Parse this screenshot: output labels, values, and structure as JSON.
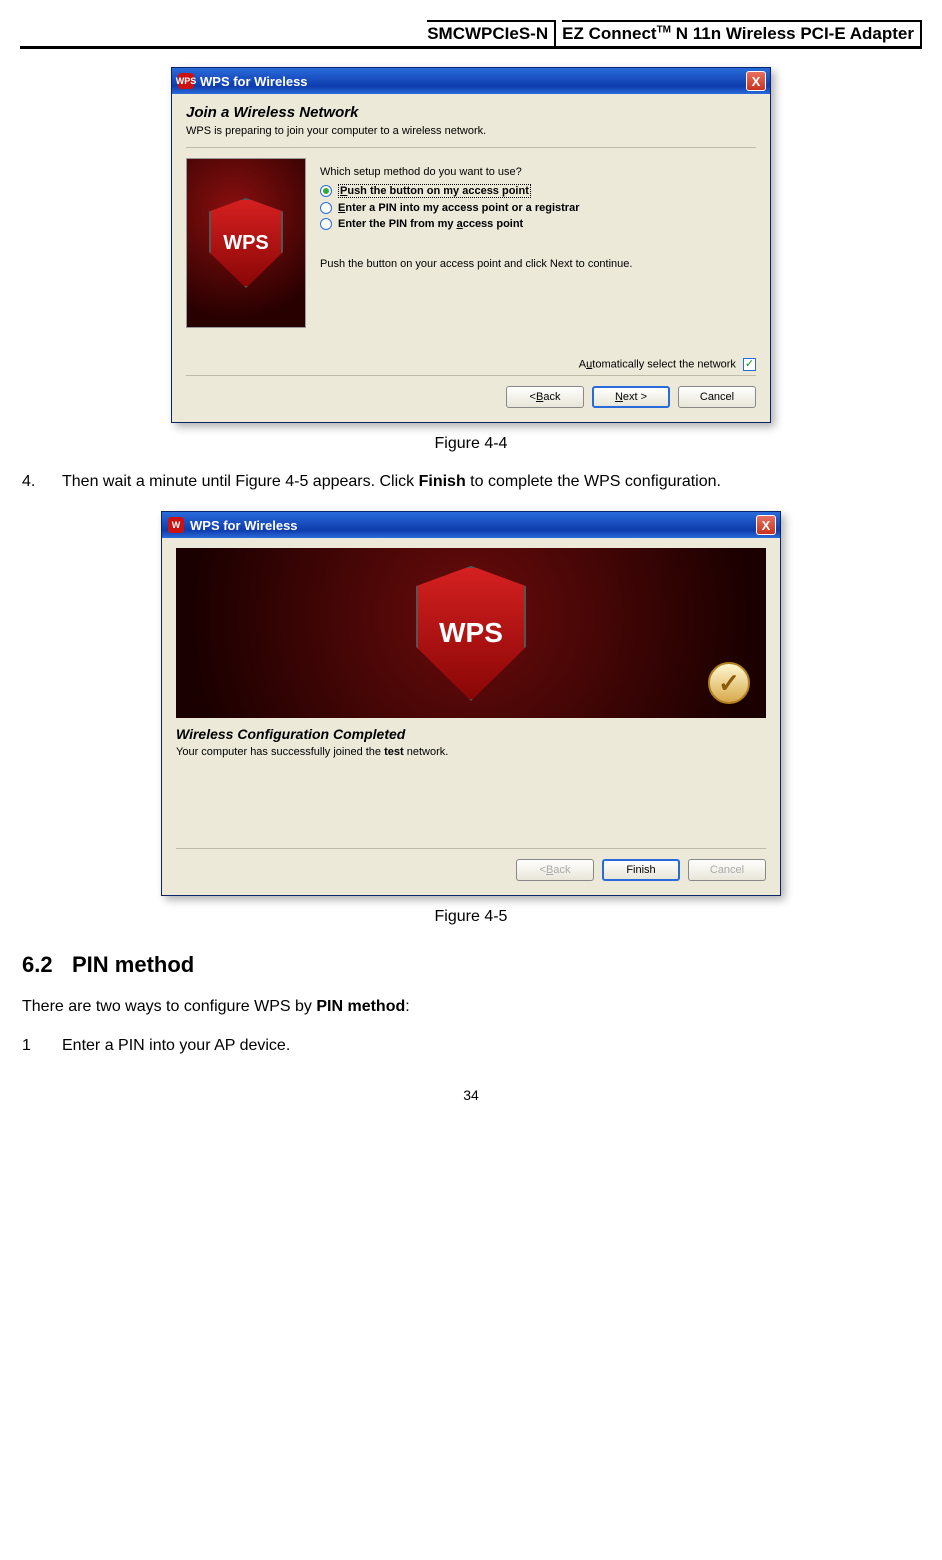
{
  "header": {
    "left": "SMCWPCIeS-N",
    "right_prefix": "EZ Connect",
    "right_tm": "TM",
    "right_suffix": " N 11n Wireless PCI-E Adapter"
  },
  "dialog1": {
    "title": "WPS for Wireless",
    "close": "X",
    "icon_text": "WPS",
    "heading": "Join a Wireless Network",
    "sub": "WPS is preparing to join your computer to a wireless network.",
    "logo": "WPS",
    "question": "Which setup method do you want to use?",
    "opt1_prefix": "P",
    "opt1_rest": "ush the button on my access point",
    "opt2_prefix": "E",
    "opt2_rest": "nter a PIN into my access point or a registrar",
    "opt3_pre": "Enter the PIN from my ",
    "opt3_u": "a",
    "opt3_post": "ccess point",
    "hint": "Push the button on your access point and click Next to continue.",
    "auto_pre": "A",
    "auto_u": "u",
    "auto_post": "tomatically select the network",
    "back_u": "B",
    "back_rest": "ack",
    "next_u": "N",
    "next_rest": "ext >",
    "cancel": "Cancel"
  },
  "caption1": "Figure 4-4",
  "step4": {
    "num": "4.",
    "pre": "Then wait a minute until Figure 4-5 appears. Click ",
    "bold": "Finish",
    "post": " to complete the WPS configuration."
  },
  "dialog2": {
    "title": "WPS for Wireless",
    "close": "X",
    "logo": "WPS",
    "check": "✓",
    "heading": "Wireless Configuration Completed",
    "p_pre": "Your computer has successfully joined the ",
    "p_bold": "test",
    "p_post": " network.",
    "back_u": "B",
    "back_rest": "ack",
    "finish": "Finish",
    "cancel": "Cancel"
  },
  "caption2": "Figure 4-5",
  "section": {
    "num": "6.2",
    "title": "PIN method"
  },
  "para_pre": "There are two ways to configure WPS by ",
  "para_bold": "PIN method",
  "para_post": ":",
  "list1": {
    "num": "1",
    "text": "Enter a PIN into your AP device."
  },
  "page_number": "34"
}
